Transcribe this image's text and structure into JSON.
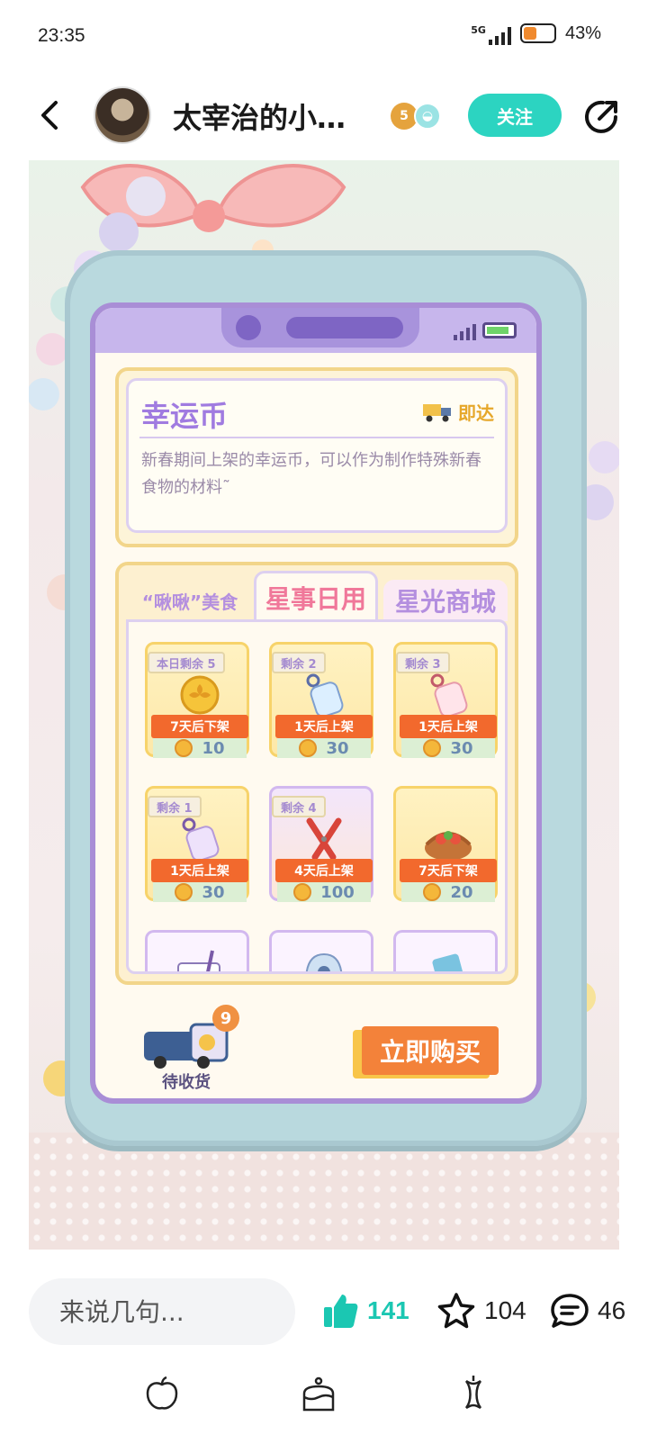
{
  "status_bar": {
    "time": "23:35",
    "network": "5G",
    "battery": "43%"
  },
  "header": {
    "author": "太宰治的小…",
    "level_badge": "5",
    "follow_label": "关注"
  },
  "post_image": {
    "item_title": "幸运币",
    "delivery_tag": "即达",
    "item_description": "新春期间上架的幸运币，可以作为制作特殊新春食物的材料˜",
    "tabs": [
      {
        "label": "“啾啾”美食"
      },
      {
        "label": "星事日用"
      },
      {
        "label": "星光商城"
      }
    ],
    "goods": [
      {
        "stock": "本日剩余 5",
        "status": "7天后下架",
        "price": "10",
        "icon": "lucky-coin-icon"
      },
      {
        "stock": "剩余 2",
        "status": "1天后上架",
        "price": "30",
        "icon": "bottle-keychain-icon"
      },
      {
        "stock": "剩余 3",
        "status": "1天后上架",
        "price": "30",
        "icon": "pink-keychain-icon"
      },
      {
        "stock": "剩余 1",
        "status": "1天后上架",
        "price": "30",
        "icon": "purple-keychain-icon"
      },
      {
        "stock": "剩余 4",
        "status": "4天后上架",
        "price": "100",
        "icon": "scissors-icon"
      },
      {
        "stock": "",
        "status": "7天后下架",
        "price": "20",
        "icon": "food-basket-icon"
      }
    ],
    "partial_goods": [
      {
        "icon": "ticket-icon"
      },
      {
        "icon": "helmet-icon"
      },
      {
        "icon": "snack-bag-icon"
      }
    ],
    "pending_count": "9",
    "pending_label": "待收货",
    "buy_label": "立即购买"
  },
  "interaction": {
    "comment_placeholder": "来说几句...",
    "likes": "141",
    "favorites": "104",
    "comments": "46"
  },
  "colors": {
    "accent": "#2cd4c1",
    "like": "#1bc7b2",
    "buy": "#f3823a"
  }
}
